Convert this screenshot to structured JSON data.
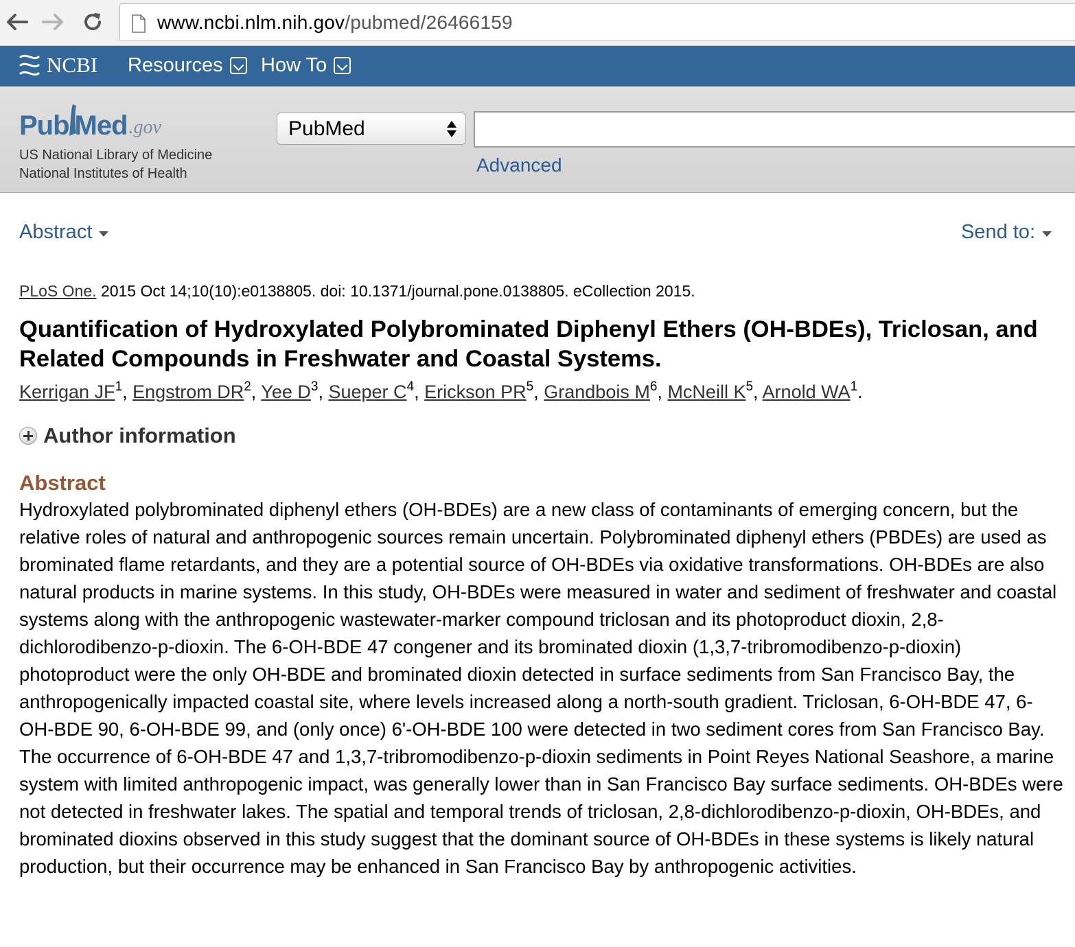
{
  "browser": {
    "url_host": "www.ncbi.nlm.nih.gov",
    "url_path": "/pubmed/26466159"
  },
  "ncbi": {
    "logo_text": "NCBI",
    "menu": [
      {
        "label": "Resources"
      },
      {
        "label": "How To"
      }
    ]
  },
  "pubmed": {
    "logo_pub": "Pub",
    "logo_med": "Med",
    "logo_gov": ".gov",
    "library_line1": "US National Library of Medicine",
    "library_line2": "National Institutes of Health",
    "db_selected": "PubMed",
    "search_value": "",
    "advanced_label": "Advanced"
  },
  "toolbar": {
    "format_label": "Abstract",
    "send_label": "Send to:"
  },
  "article": {
    "journal": "PLoS One.",
    "citation_rest": " 2015 Oct 14;10(10):e0138805. doi: 10.1371/journal.pone.0138805. eCollection 2015.",
    "title": "Quantification of Hydroxylated Polybrominated Diphenyl Ethers (OH-BDEs), Triclosan, and Related Compounds in Freshwater and Coastal Systems.",
    "authors": [
      {
        "name": "Kerrigan JF",
        "aff": "1"
      },
      {
        "name": "Engstrom DR",
        "aff": "2"
      },
      {
        "name": "Yee D",
        "aff": "3"
      },
      {
        "name": "Sueper C",
        "aff": "4"
      },
      {
        "name": "Erickson PR",
        "aff": "5"
      },
      {
        "name": "Grandbois M",
        "aff": "6"
      },
      {
        "name": "McNeill K",
        "aff": "5"
      },
      {
        "name": "Arnold WA",
        "aff": "1"
      }
    ],
    "author_info_label": "Author information",
    "abstract_heading": "Abstract",
    "abstract": "Hydroxylated polybrominated diphenyl ethers (OH-BDEs) are a new class of contaminants of emerging concern, but the relative roles of natural and anthropogenic sources remain uncertain. Polybrominated diphenyl ethers (PBDEs) are used as brominated flame retardants, and they are a potential source of OH-BDEs via oxidative transformations. OH-BDEs are also natural products in marine systems. In this study, OH-BDEs were measured in water and sediment of freshwater and coastal systems along with the anthropogenic wastewater-marker compound triclosan and its photoproduct dioxin, 2,8-dichlorodibenzo-p-dioxin. The 6-OH-BDE 47 congener and its brominated dioxin (1,3,7-tribromodibenzo-p-dioxin) photoproduct were the only OH-BDE and brominated dioxin detected in surface sediments from San Francisco Bay, the anthropogenically impacted coastal site, where levels increased along a north-south gradient. Triclosan, 6-OH-BDE 47, 6-OH-BDE 90, 6-OH-BDE 99, and (only once) 6'-OH-BDE 100 were detected in two sediment cores from San Francisco Bay. The occurrence of 6-OH-BDE 47 and 1,3,7-tribromodibenzo-p-dioxin sediments in Point Reyes National Seashore, a marine system with limited anthropogenic impact, was generally lower than in San Francisco Bay surface sediments. OH-BDEs were not detected in freshwater lakes. The spatial and temporal trends of triclosan, 2,8-dichlorodibenzo-p-dioxin, OH-BDEs, and brominated dioxins observed in this study suggest that the dominant source of OH-BDEs in these systems is likely natural production, but their occurrence may be enhanced in San Francisco Bay by anthropogenic activities."
  },
  "colors": {
    "ncbi_bar": "#336699",
    "link": "#2c5a93",
    "abstract_heading": "#985735"
  }
}
